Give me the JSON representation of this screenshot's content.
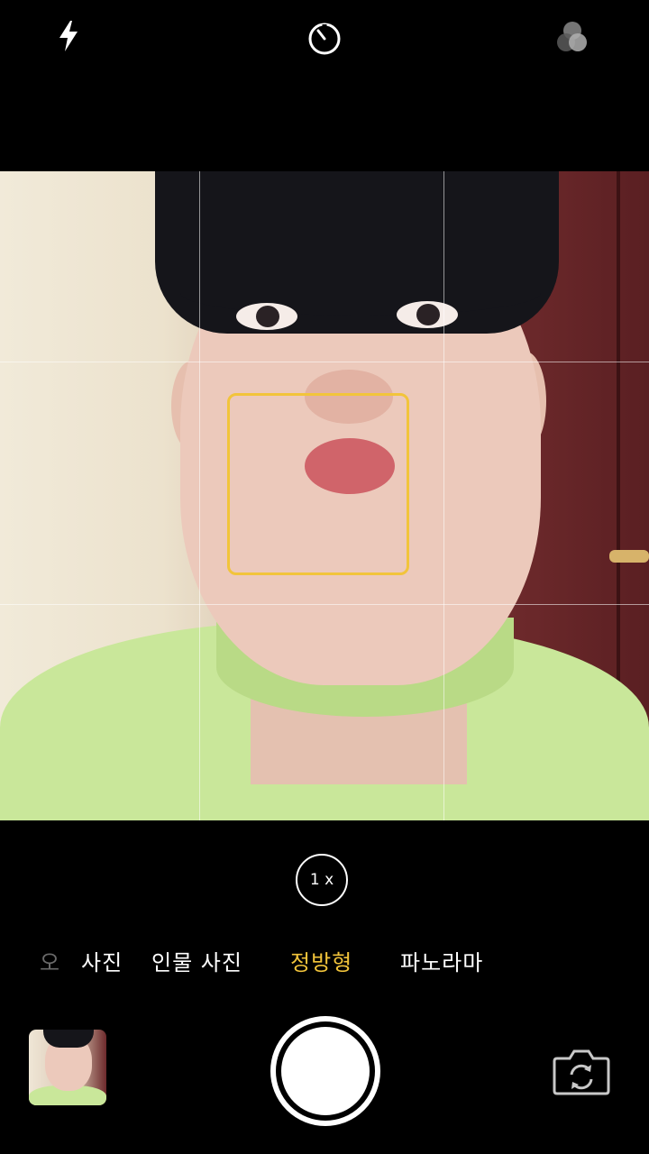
{
  "top_bar": {
    "icons": [
      "flash-icon",
      "timer-icon",
      "live-filters-icon"
    ]
  },
  "viewfinder": {
    "focus_color": "#f2c43b",
    "grid": "3x3"
  },
  "zoom": {
    "label": "1 x"
  },
  "modes": {
    "items": [
      {
        "label": "오",
        "state": "partial"
      },
      {
        "label": "사진",
        "state": "normal"
      },
      {
        "label": "인물 사진",
        "state": "normal"
      },
      {
        "label": "정방형",
        "state": "active"
      },
      {
        "label": "파노라마",
        "state": "normal"
      }
    ],
    "active_color": "#f2c43b"
  },
  "bottom_bar": {
    "icons": [
      "last-photo-thumbnail",
      "shutter-button",
      "switch-camera-icon"
    ]
  }
}
